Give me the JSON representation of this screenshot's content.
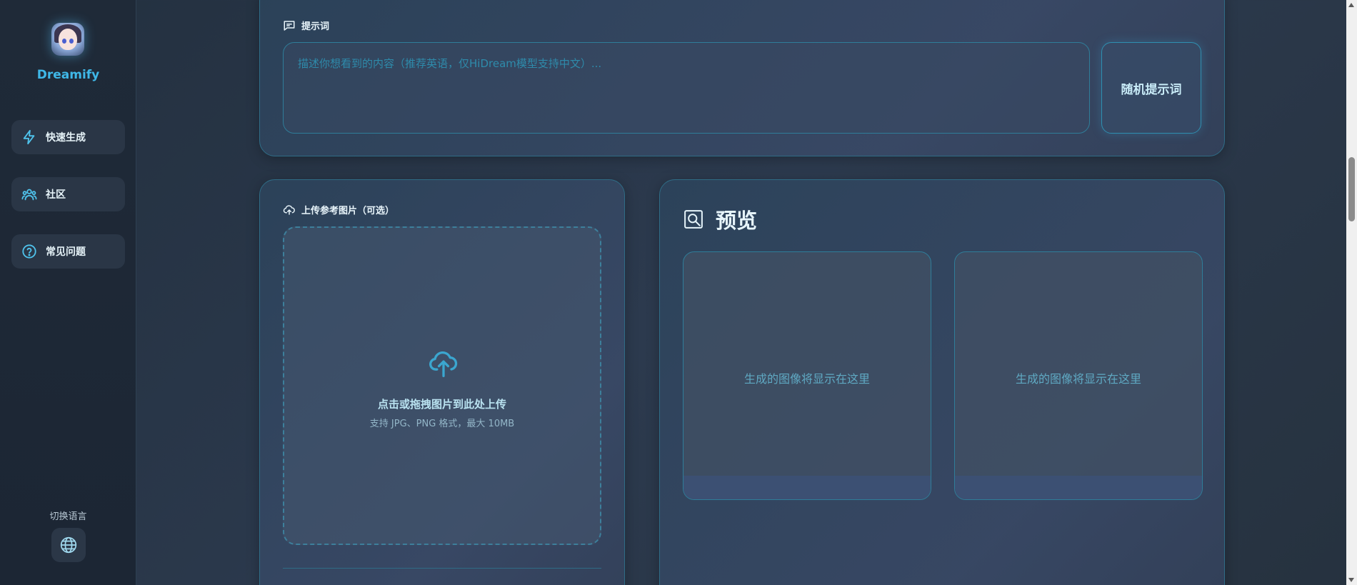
{
  "app": {
    "brand": "Dreamify"
  },
  "sidebar": {
    "items": [
      {
        "label": "快速生成",
        "icon": "lightning-icon"
      },
      {
        "label": "社区",
        "icon": "users-icon"
      },
      {
        "label": "常见问题",
        "icon": "help-circle-icon"
      }
    ],
    "language_label": "切换语言",
    "language_icon": "globe-icon"
  },
  "prompt": {
    "title": "提示词",
    "placeholder": "描述你想看到的内容（推荐英语，仅HiDream模型支持中文）...",
    "random_button": "随机提示词"
  },
  "upload": {
    "title": "上传参考图片（可选）",
    "main_text": "点击或拖拽图片到此处上传",
    "sub_text": "支持 JPG、PNG 格式，最大 10MB"
  },
  "preview": {
    "title": "预览",
    "slots": [
      {
        "text": "生成的图像将显示在这里"
      },
      {
        "text": "生成的图像将显示在这里"
      }
    ]
  },
  "colors": {
    "accent": "#3fb8e8",
    "background": "#2a3748",
    "border": "#2f6c86"
  }
}
